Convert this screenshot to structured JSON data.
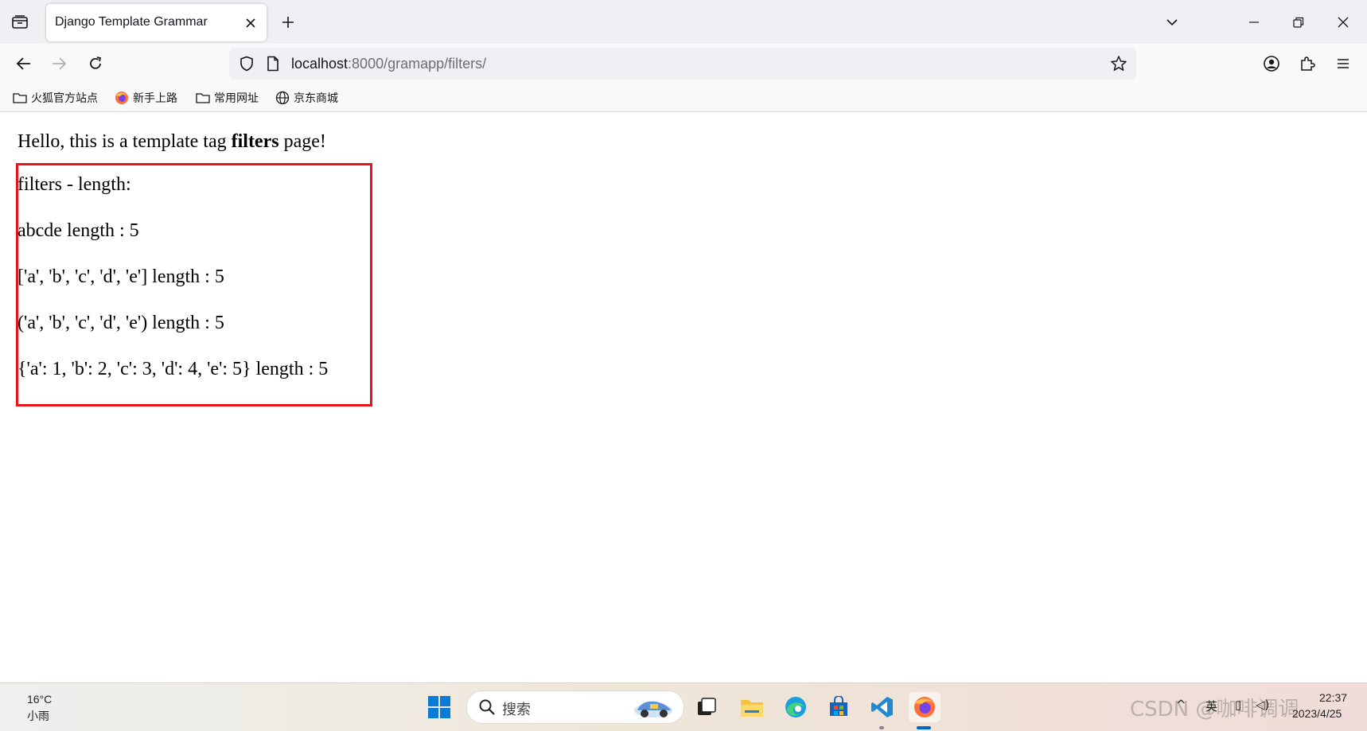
{
  "browser": {
    "tab": {
      "title": "Django Template Grammar"
    },
    "url": {
      "host": "localhost",
      "rest": ":8000/gramapp/filters/"
    },
    "bookmarks": [
      {
        "label": "火狐官方站点",
        "icon": "folder-icon"
      },
      {
        "label": "新手上路",
        "icon": "firefox-icon"
      },
      {
        "label": "常用网址",
        "icon": "folder-icon"
      },
      {
        "label": "京东商城",
        "icon": "globe-icon"
      }
    ]
  },
  "page": {
    "heading": {
      "before": "Hello, this is a template tag ",
      "bold": "filters",
      "after": " page!"
    },
    "lines": [
      "filters - length:",
      "abcde length : 5",
      "['a', 'b', 'c', 'd', 'e'] length : 5",
      "('a', 'b', 'c', 'd', 'e') length : 5",
      "{'a': 1, 'b': 2, 'c': 3, 'd': 4, 'e': 5} length : 5"
    ],
    "highlight_color": "#e8141b"
  },
  "taskbar": {
    "weather": {
      "temp": "16°C",
      "desc": "小雨"
    },
    "search_placeholder": "搜索",
    "tray": {
      "lang": "英"
    },
    "clock": {
      "time": "22:37",
      "date": "2023/4/25"
    },
    "watermark": "CSDN @咖啡调调"
  }
}
